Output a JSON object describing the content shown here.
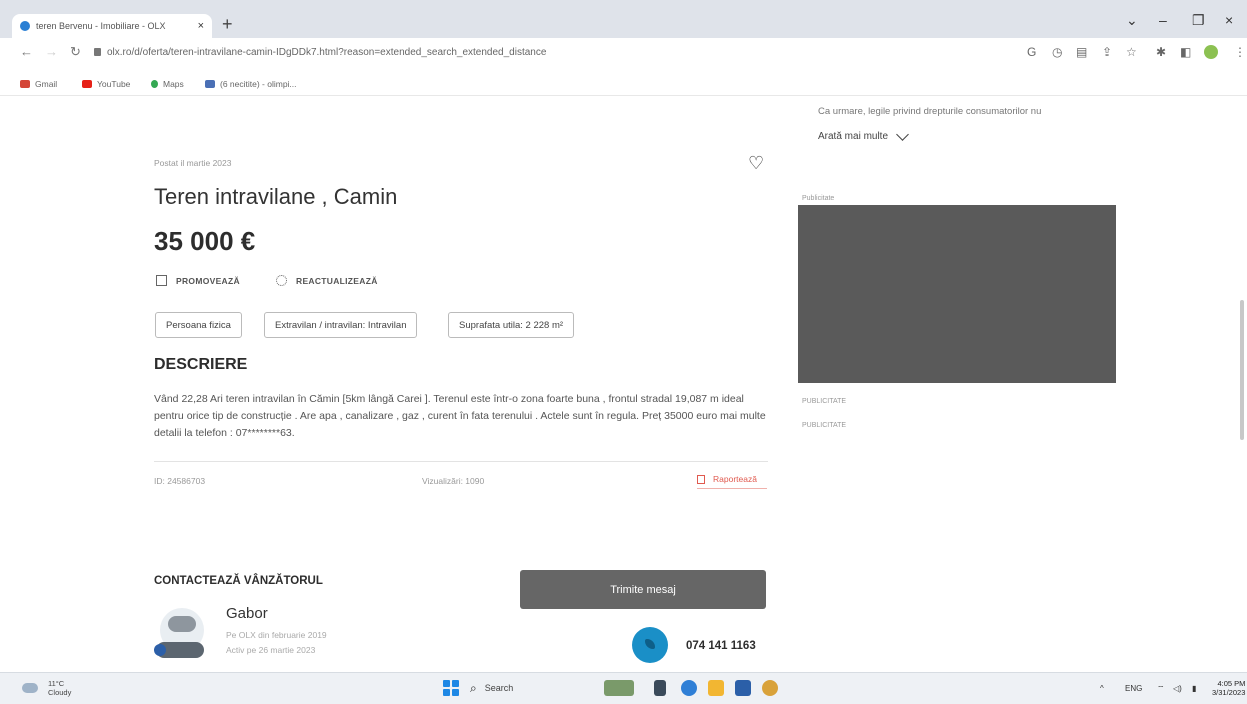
{
  "browser": {
    "tab_title": "teren Bervenu - Imobiliare - OLX",
    "tab_close": "×",
    "new_tab": "+",
    "url": "olx.ro/d/oferta/teren-intravilane-camin-IDgDDk7.html?reason=extended_search_extended_distance",
    "bookmarks": [
      "Gmail",
      "YouTube",
      "Maps",
      "(6 necitite) - olimpi..."
    ],
    "window_controls": [
      "⌄",
      "–",
      "❐",
      "×"
    ]
  },
  "listing": {
    "posted": "Postat il martie 2023",
    "title": "Teren intravilane , Camin",
    "price": "35 000 €",
    "promote_label": "PROMOVEAZĂ",
    "refresh_label": "REACTUALIZEAZĂ",
    "tags": [
      "Persoana fizica",
      "Extravilan / intravilan: Intravilan",
      "Suprafata utila: 2 228 m²"
    ],
    "description_heading": "DESCRIERE",
    "description": "Vând 22,28 Ari teren intravilan în Cămin [5km lângă Carei ]. Terenul este într-o zona foarte buna , frontul stradal 19,087 m ideal pentru orice tip de construcție . Are apa , canalizare , gaz , curent în fata terenului . Actele sunt în regula. Preț 35000 euro mai multe detalii la telefon : 07********63.",
    "id_text": "ID: 24586703",
    "views_text": "Vizualizări: 1090",
    "report_label": "Raportează"
  },
  "contact": {
    "heading": "CONTACTEAZĂ VÂNZĂTORUL",
    "message_button": "Trimite mesaj",
    "seller_name": "Gabor",
    "seller_since": "Pe OLX din februarie 2019",
    "seller_active": "Activ pe 26 martie 2023",
    "phone": "074 141 1163"
  },
  "sidebar": {
    "consumer_text": "Ca urmare, legile privind drepturile consumatorilor nu",
    "show_more": "Arată mai multe",
    "ad_label_top": "Publicitate",
    "ad_label_1": "PUBLICITATE",
    "ad_label_2": "PUBLICITATE"
  },
  "taskbar": {
    "weather_temp": "11°C",
    "weather_desc": "Cloudy",
    "search_label": "Search",
    "lang": "ENG",
    "time": "4:05 PM",
    "date": "3/31/2023"
  },
  "colors": {
    "report": "#e05a4f",
    "message_button": "#666666",
    "phone_icon": "#1a8fc7"
  }
}
